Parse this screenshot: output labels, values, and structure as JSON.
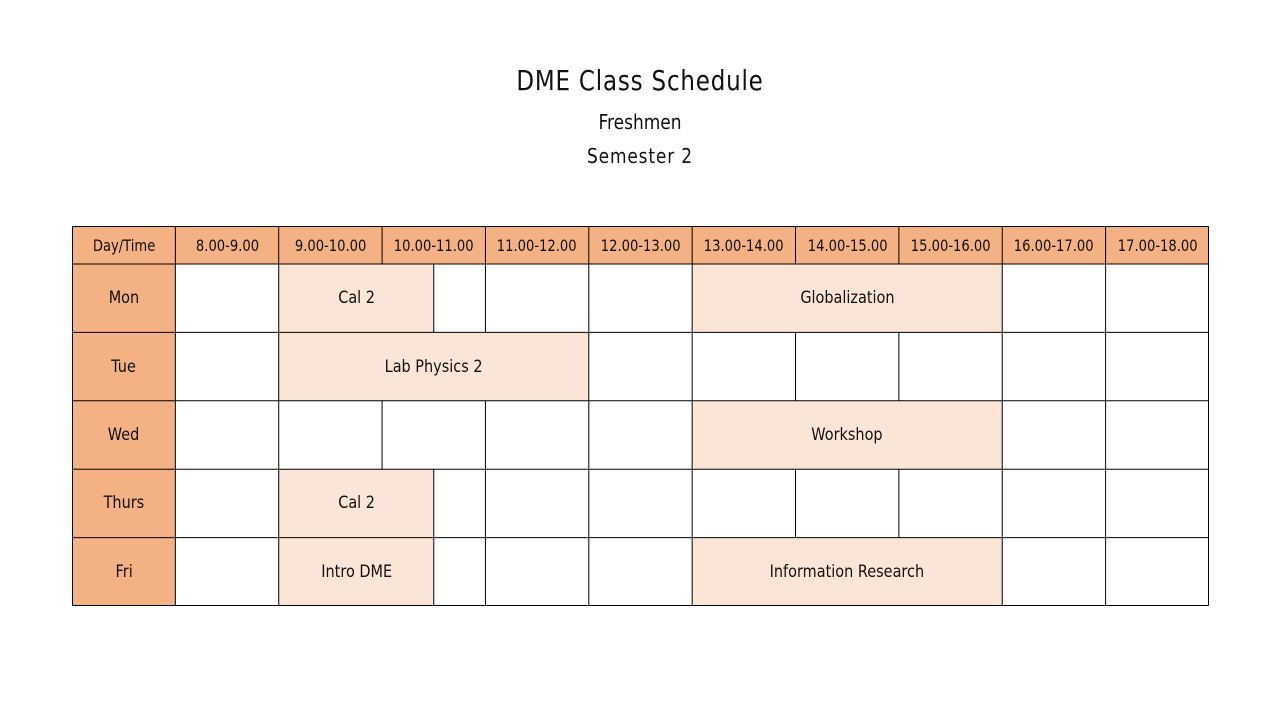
{
  "title": "DME  Class  Schedule",
  "subtitle": "Freshmen",
  "semester": "Semester  2",
  "colors": {
    "header_fill": "#f4b183",
    "class_fill": "#fbe5d6",
    "grid_line": "#000000"
  },
  "corner_label": "Day/Time",
  "time_slots": [
    "8.00-9.00",
    "9.00-10.00",
    "10.00-11.00",
    "11.00-12.00",
    "12.00-13.00",
    "13.00-14.00",
    "14.00-15.00",
    "15.00-16.00",
    "16.00-17.00",
    "17.00-18.00"
  ],
  "days": [
    {
      "label": "Mon",
      "cells": [
        {
          "span": 1
        },
        {
          "span": 1.5,
          "label": "Cal 2"
        },
        {
          "span": 0.5
        },
        {
          "span": 1
        },
        {
          "span": 1
        },
        {
          "span": 3,
          "label": "Globalization"
        },
        {
          "span": 1
        },
        {
          "span": 1
        }
      ]
    },
    {
      "label": "Tue",
      "cells": [
        {
          "span": 1
        },
        {
          "span": 3,
          "label": "Lab  Physics  2"
        },
        {
          "span": 1
        },
        {
          "span": 1
        },
        {
          "span": 1
        },
        {
          "span": 1
        },
        {
          "span": 1
        }
      ]
    },
    {
      "label": "Wed",
      "cells": [
        {
          "span": 1
        },
        {
          "span": 1
        },
        {
          "span": 1
        },
        {
          "span": 1
        },
        {
          "span": 1
        },
        {
          "span": 3,
          "label": "Workshop"
        },
        {
          "span": 1
        },
        {
          "span": 1
        }
      ]
    },
    {
      "label": "Thurs",
      "cells": [
        {
          "span": 1
        },
        {
          "span": 1.5,
          "label": "Cal  2"
        },
        {
          "span": 0.5
        },
        {
          "span": 1
        },
        {
          "span": 1
        },
        {
          "span": 1
        },
        {
          "span": 1
        },
        {
          "span": 1
        },
        {
          "span": 1
        },
        {
          "span": 1
        }
      ]
    },
    {
      "label": "Fri",
      "cells": [
        {
          "span": 1
        },
        {
          "span": 1.5,
          "label": "Intro  DME"
        },
        {
          "span": 0.5
        },
        {
          "span": 1
        },
        {
          "span": 1
        },
        {
          "span": 3,
          "label": "Information  Research"
        },
        {
          "span": 1
        },
        {
          "span": 1
        }
      ]
    }
  ]
}
